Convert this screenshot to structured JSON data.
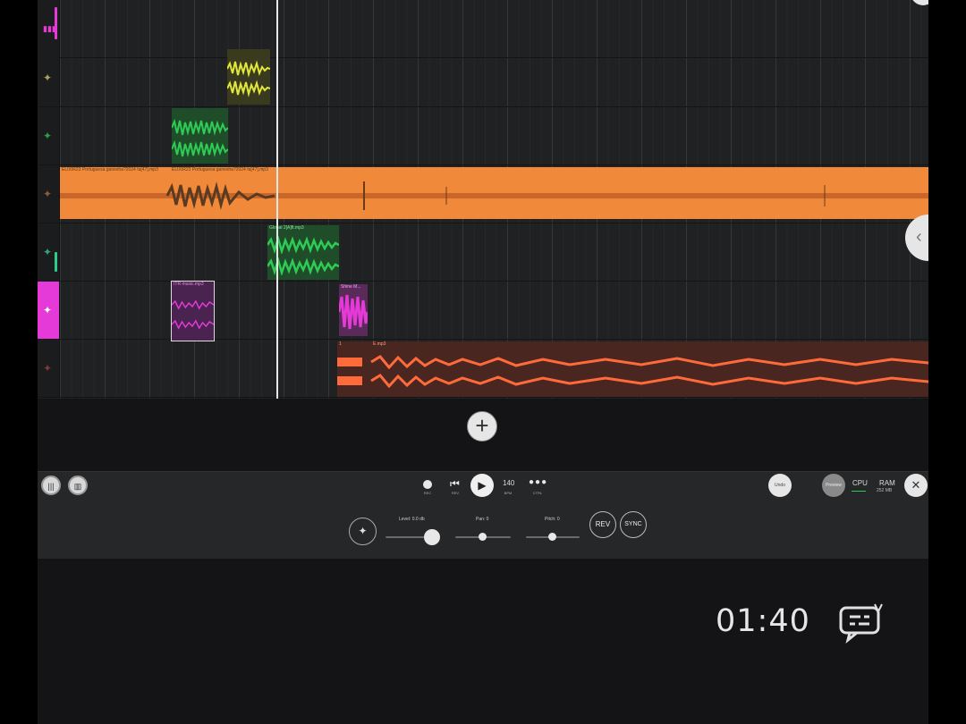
{
  "colors": {
    "orange": "#f08a3a",
    "green": "#2ecc55",
    "yellow": "#e2e83a",
    "magenta": "#e53ad8",
    "red": "#ff6a3a"
  },
  "tracks": [
    {
      "icon": "meter-icon",
      "glyph": "▮▮▮",
      "color": "#e53ad8"
    },
    {
      "icon": "node-icon",
      "glyph": "✦",
      "color": "#a9a35c"
    },
    {
      "icon": "node-icon",
      "glyph": "✦",
      "color": "#2e9e48"
    },
    {
      "icon": "node-icon",
      "glyph": "✦",
      "color": "#8a5a3a"
    },
    {
      "icon": "node-icon",
      "glyph": "✦",
      "color": "#2ea57a"
    },
    {
      "icon": "node-icon",
      "glyph": "✦",
      "color": "#ffffff"
    },
    {
      "icon": "node-icon",
      "glyph": "✦",
      "color": "#7a3a3a"
    }
  ],
  "clips": {
    "orange_label_1": "ELIXIR23 Portuguesa ganesha?2024 fa[47].mp3",
    "orange_label_2": "ELIXIR23 Portuguesa ganesha?2024 fa[47].mp3",
    "green_label": "Global 2[A]ft.mp3",
    "pink_label_1": "ITR music.mp3",
    "pink_label_2": "Shine M...",
    "red_label_1": "1",
    "red_label_2": "E.mp3"
  },
  "transport": {
    "rec_label": "REC",
    "rev_label": "REV",
    "bpm_value": "140",
    "bpm_label": "BPM",
    "ctrl_label": "CTRL",
    "undo_label": "Undo",
    "preview_label": "Preview",
    "cpu_label": "CPU",
    "ram_label": "RAM",
    "ram_value": "252 MB"
  },
  "controls": {
    "level_label": "Level: 0.0 db",
    "pan_label": "Pan: 0",
    "pitch_label": "Pitch: 0",
    "level_fraction": 0.85,
    "pan_fraction": 0.5,
    "pitch_fraction": 0.5,
    "rev_button": "REV",
    "sync_button": "SYNC"
  },
  "timer": "01:40"
}
